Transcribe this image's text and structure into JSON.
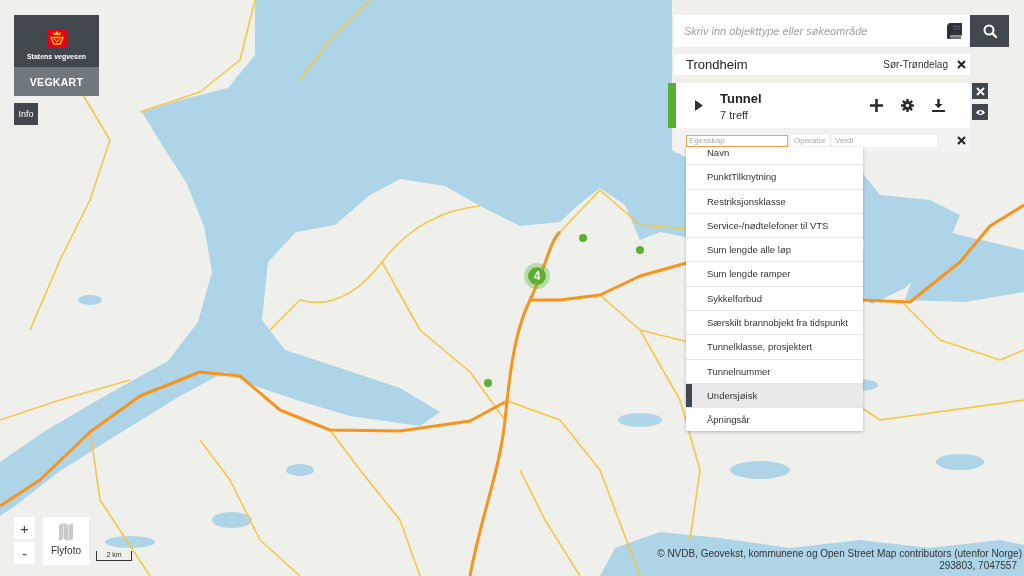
{
  "brand": {
    "agency": "Statens vegvesen",
    "app": "VEGKART"
  },
  "info_button": "Info",
  "search": {
    "placeholder": "Skriv inn objekttype eller søkeområde"
  },
  "area": {
    "name": "Trondheim",
    "region": "Sør-Trøndelag"
  },
  "result": {
    "title": "Tunnel",
    "count": "7 treff",
    "expanded": false
  },
  "filter": {
    "fields": [
      {
        "placeholder": "Egenskap",
        "focused": true
      },
      {
        "placeholder": "Operator",
        "focused": false
      },
      {
        "placeholder": "Verdi",
        "focused": false
      }
    ]
  },
  "dropdown": {
    "items": [
      {
        "label": "Navn",
        "selected": false
      },
      {
        "label": "PunktTilknytning",
        "selected": false
      },
      {
        "label": "Restriksjonsklasse",
        "selected": false
      },
      {
        "label": "Service-/nødtelefoner til VTS",
        "selected": false
      },
      {
        "label": "Sum lengde alle løp",
        "selected": false
      },
      {
        "label": "Sum lengde ramper",
        "selected": false
      },
      {
        "label": "Sykkelforbud",
        "selected": false
      },
      {
        "label": "Særskilt brannobjekt fra tidspunkt",
        "selected": false
      },
      {
        "label": "Tunnelklasse, prosjektert",
        "selected": false
      },
      {
        "label": "Tunnelnummer",
        "selected": false
      },
      {
        "label": "Undersjøisk",
        "selected": true
      },
      {
        "label": "Åpningsår",
        "selected": false
      }
    ]
  },
  "map": {
    "markers": [
      {
        "kind": "cluster",
        "count": "4"
      },
      {
        "kind": "point"
      },
      {
        "kind": "point"
      },
      {
        "kind": "point"
      }
    ]
  },
  "map_controls": {
    "zoom_in": "+",
    "zoom_out": "-",
    "layer_button": "Flyfoto",
    "scale": "2 km"
  },
  "attribution": "© NVDB, Geovekst, kommunene og Open Street Map contributors (utenfor Norge)",
  "coordinates": "293803, 7047557"
}
